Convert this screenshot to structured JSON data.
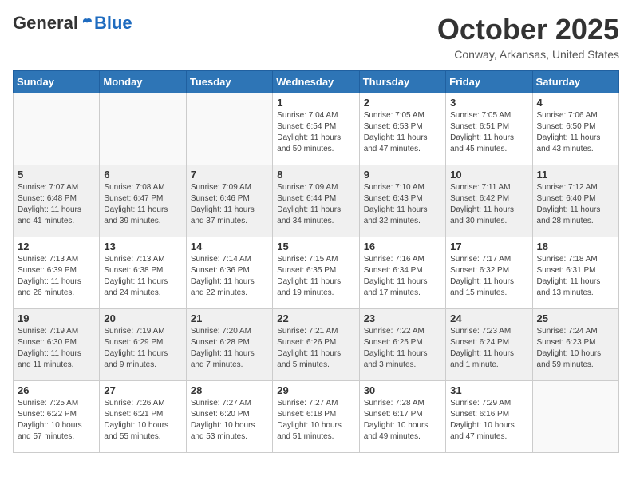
{
  "logo": {
    "general": "General",
    "blue": "Blue"
  },
  "title": "October 2025",
  "location": "Conway, Arkansas, United States",
  "weekdays": [
    "Sunday",
    "Monday",
    "Tuesday",
    "Wednesday",
    "Thursday",
    "Friday",
    "Saturday"
  ],
  "weeks": [
    [
      {
        "day": "",
        "info": ""
      },
      {
        "day": "",
        "info": ""
      },
      {
        "day": "",
        "info": ""
      },
      {
        "day": "1",
        "info": "Sunrise: 7:04 AM\nSunset: 6:54 PM\nDaylight: 11 hours\nand 50 minutes."
      },
      {
        "day": "2",
        "info": "Sunrise: 7:05 AM\nSunset: 6:53 PM\nDaylight: 11 hours\nand 47 minutes."
      },
      {
        "day": "3",
        "info": "Sunrise: 7:05 AM\nSunset: 6:51 PM\nDaylight: 11 hours\nand 45 minutes."
      },
      {
        "day": "4",
        "info": "Sunrise: 7:06 AM\nSunset: 6:50 PM\nDaylight: 11 hours\nand 43 minutes."
      }
    ],
    [
      {
        "day": "5",
        "info": "Sunrise: 7:07 AM\nSunset: 6:48 PM\nDaylight: 11 hours\nand 41 minutes."
      },
      {
        "day": "6",
        "info": "Sunrise: 7:08 AM\nSunset: 6:47 PM\nDaylight: 11 hours\nand 39 minutes."
      },
      {
        "day": "7",
        "info": "Sunrise: 7:09 AM\nSunset: 6:46 PM\nDaylight: 11 hours\nand 37 minutes."
      },
      {
        "day": "8",
        "info": "Sunrise: 7:09 AM\nSunset: 6:44 PM\nDaylight: 11 hours\nand 34 minutes."
      },
      {
        "day": "9",
        "info": "Sunrise: 7:10 AM\nSunset: 6:43 PM\nDaylight: 11 hours\nand 32 minutes."
      },
      {
        "day": "10",
        "info": "Sunrise: 7:11 AM\nSunset: 6:42 PM\nDaylight: 11 hours\nand 30 minutes."
      },
      {
        "day": "11",
        "info": "Sunrise: 7:12 AM\nSunset: 6:40 PM\nDaylight: 11 hours\nand 28 minutes."
      }
    ],
    [
      {
        "day": "12",
        "info": "Sunrise: 7:13 AM\nSunset: 6:39 PM\nDaylight: 11 hours\nand 26 minutes."
      },
      {
        "day": "13",
        "info": "Sunrise: 7:13 AM\nSunset: 6:38 PM\nDaylight: 11 hours\nand 24 minutes."
      },
      {
        "day": "14",
        "info": "Sunrise: 7:14 AM\nSunset: 6:36 PM\nDaylight: 11 hours\nand 22 minutes."
      },
      {
        "day": "15",
        "info": "Sunrise: 7:15 AM\nSunset: 6:35 PM\nDaylight: 11 hours\nand 19 minutes."
      },
      {
        "day": "16",
        "info": "Sunrise: 7:16 AM\nSunset: 6:34 PM\nDaylight: 11 hours\nand 17 minutes."
      },
      {
        "day": "17",
        "info": "Sunrise: 7:17 AM\nSunset: 6:32 PM\nDaylight: 11 hours\nand 15 minutes."
      },
      {
        "day": "18",
        "info": "Sunrise: 7:18 AM\nSunset: 6:31 PM\nDaylight: 11 hours\nand 13 minutes."
      }
    ],
    [
      {
        "day": "19",
        "info": "Sunrise: 7:19 AM\nSunset: 6:30 PM\nDaylight: 11 hours\nand 11 minutes."
      },
      {
        "day": "20",
        "info": "Sunrise: 7:19 AM\nSunset: 6:29 PM\nDaylight: 11 hours\nand 9 minutes."
      },
      {
        "day": "21",
        "info": "Sunrise: 7:20 AM\nSunset: 6:28 PM\nDaylight: 11 hours\nand 7 minutes."
      },
      {
        "day": "22",
        "info": "Sunrise: 7:21 AM\nSunset: 6:26 PM\nDaylight: 11 hours\nand 5 minutes."
      },
      {
        "day": "23",
        "info": "Sunrise: 7:22 AM\nSunset: 6:25 PM\nDaylight: 11 hours\nand 3 minutes."
      },
      {
        "day": "24",
        "info": "Sunrise: 7:23 AM\nSunset: 6:24 PM\nDaylight: 11 hours\nand 1 minute."
      },
      {
        "day": "25",
        "info": "Sunrise: 7:24 AM\nSunset: 6:23 PM\nDaylight: 10 hours\nand 59 minutes."
      }
    ],
    [
      {
        "day": "26",
        "info": "Sunrise: 7:25 AM\nSunset: 6:22 PM\nDaylight: 10 hours\nand 57 minutes."
      },
      {
        "day": "27",
        "info": "Sunrise: 7:26 AM\nSunset: 6:21 PM\nDaylight: 10 hours\nand 55 minutes."
      },
      {
        "day": "28",
        "info": "Sunrise: 7:27 AM\nSunset: 6:20 PM\nDaylight: 10 hours\nand 53 minutes."
      },
      {
        "day": "29",
        "info": "Sunrise: 7:27 AM\nSunset: 6:18 PM\nDaylight: 10 hours\nand 51 minutes."
      },
      {
        "day": "30",
        "info": "Sunrise: 7:28 AM\nSunset: 6:17 PM\nDaylight: 10 hours\nand 49 minutes."
      },
      {
        "day": "31",
        "info": "Sunrise: 7:29 AM\nSunset: 6:16 PM\nDaylight: 10 hours\nand 47 minutes."
      },
      {
        "day": "",
        "info": ""
      }
    ]
  ]
}
